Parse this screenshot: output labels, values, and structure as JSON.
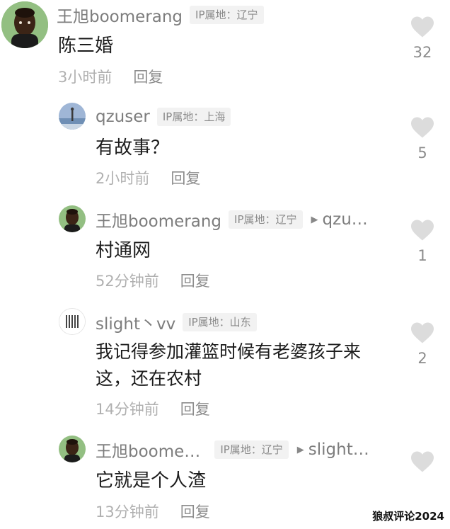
{
  "comments": [
    {
      "username": "王旭boomerang",
      "ip": "IP属地：辽宁",
      "text": "陈三婚",
      "time": "3小时前",
      "reply_label": "回复",
      "likes": "32"
    },
    {
      "username": "qzuser",
      "ip": "IP属地：上海",
      "text": "有故事？",
      "time": "2小时前",
      "reply_label": "回复",
      "likes": "5"
    },
    {
      "username": "王旭boomerang",
      "ip": "IP属地：辽宁",
      "reply_to": "qzu…",
      "text": "村通网",
      "time": "52分钟前",
      "reply_label": "回复",
      "likes": "1"
    },
    {
      "username": "slight丶vv",
      "ip": "IP属地：山东",
      "text_line1": "我记得参加灌篮时候有老婆孩子来",
      "text_line2": "这，还在农村",
      "time": "14分钟前",
      "reply_label": "回复",
      "likes": "2"
    },
    {
      "username": "王旭boome…",
      "ip": "IP属地：辽宁",
      "reply_to": "slight…",
      "text": "它就是个人渣",
      "time": "13分钟前",
      "reply_label": "回复",
      "likes": ""
    }
  ],
  "watermark": "狼叔评论2024",
  "colors": {
    "heart": "#dcdcdc",
    "username": "#7d7d7d",
    "ip_bg": "#f2f2f2"
  }
}
